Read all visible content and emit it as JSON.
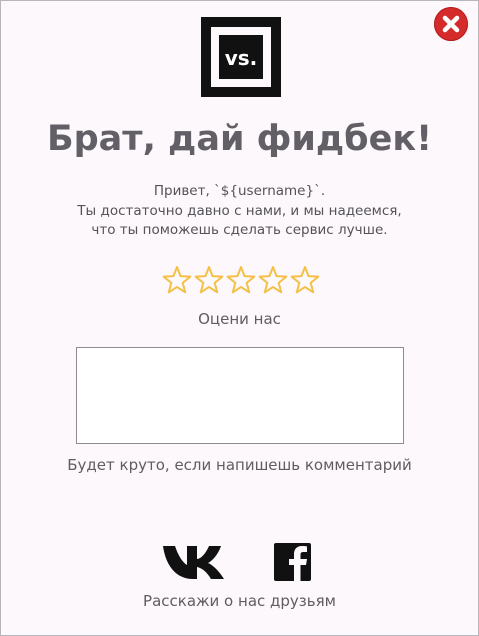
{
  "dialog": {
    "title": "Брат, дай фидбек!",
    "intro_lines": [
      "Привет, `${username}`.",
      "Ты достаточно давно с нами, и мы надеемся,",
      "что ты поможешь сделать сервис лучше."
    ],
    "logo_text": "vs.",
    "rating": {
      "label": "Оцени нас",
      "max": 5,
      "value": 0,
      "star_color": "#f5c048"
    },
    "comment": {
      "value": "",
      "hint": "Будет круто, если напишешь комментарий"
    },
    "share": {
      "label": "Расскажи о нас друзьям",
      "networks": [
        "vk-icon",
        "facebook-icon"
      ]
    },
    "close_icon": "close-icon"
  },
  "colors": {
    "accent_close": "#d52b2b",
    "background": "#fcf8fc",
    "text": "#626066"
  }
}
